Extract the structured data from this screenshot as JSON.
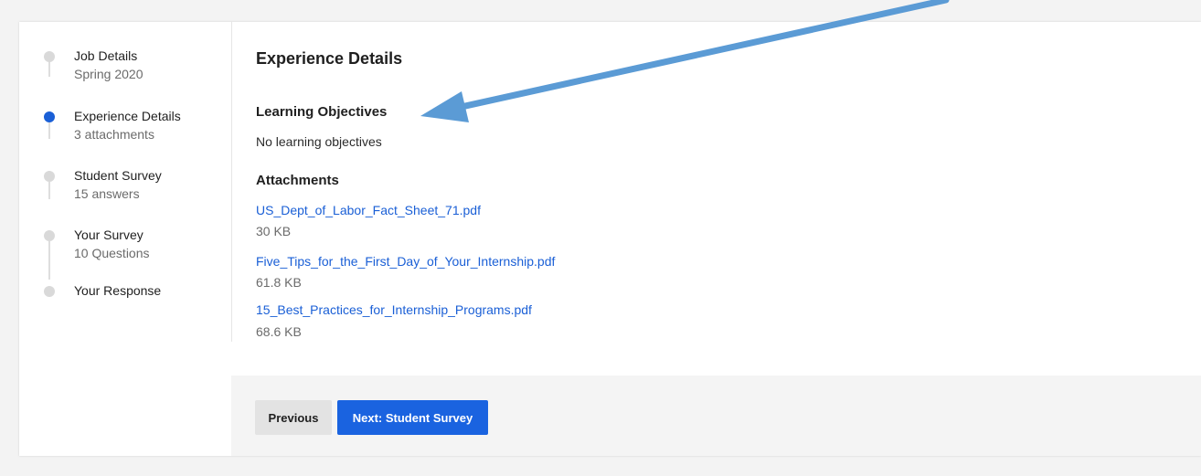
{
  "steps": [
    {
      "title": "Job Details",
      "subtitle": "Spring 2020",
      "active": false
    },
    {
      "title": "Experience Details",
      "subtitle": "3 attachments",
      "active": true
    },
    {
      "title": "Student Survey",
      "subtitle": "15 answers",
      "active": false
    },
    {
      "title": "Your Survey",
      "subtitle": "10 Questions",
      "active": false
    },
    {
      "title": "Your Response",
      "subtitle": "",
      "active": false
    }
  ],
  "main": {
    "title": "Experience Details",
    "learning_objectives": {
      "heading": "Learning Objectives",
      "text": "No learning objectives"
    },
    "attachments": {
      "heading": "Attachments",
      "items": [
        {
          "name": "US_Dept_of_Labor_Fact_Sheet_71.pdf",
          "size": "30 KB"
        },
        {
          "name": "Five_Tips_for_the_First_Day_of_Your_Internship.pdf",
          "size": "61.8 KB"
        },
        {
          "name": "15_Best_Practices_for_Internship_Programs.pdf",
          "size": "68.6 KB"
        }
      ]
    }
  },
  "footer": {
    "previous_label": "Previous",
    "next_label": "Next: Student Survey"
  },
  "colors": {
    "accent": "#1a5fd6",
    "annotation_arrow": "#5b9bd5"
  }
}
